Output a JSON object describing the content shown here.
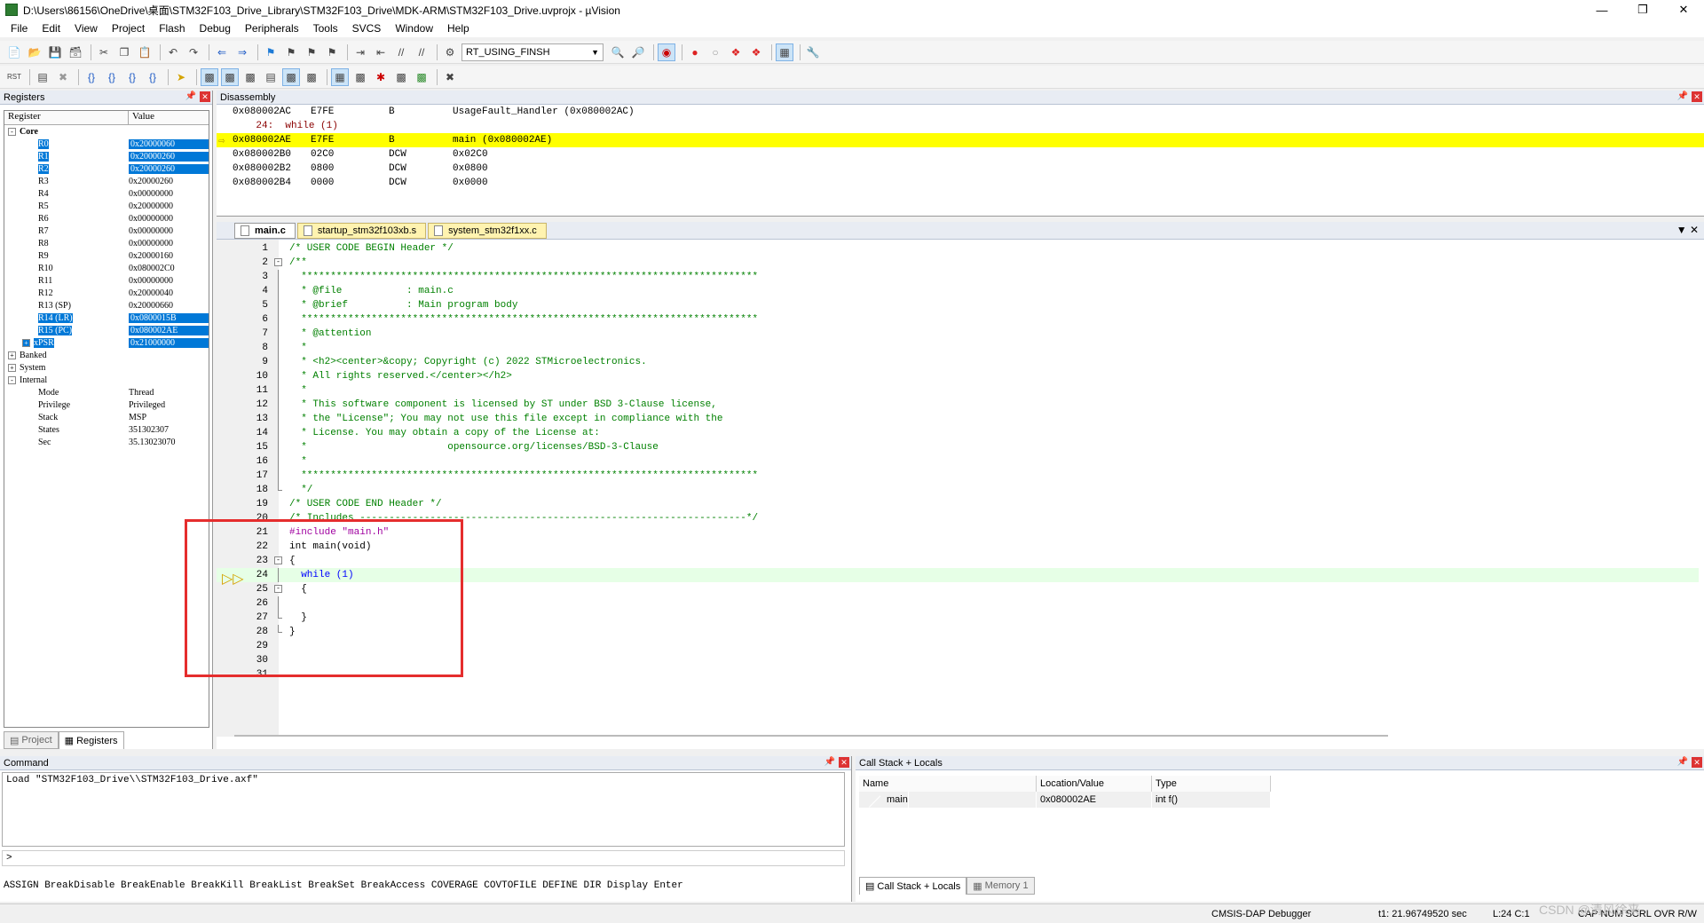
{
  "window": {
    "title": "D:\\Users\\86156\\OneDrive\\桌面\\STM32F103_Drive_Library\\STM32F103_Drive\\MDK-ARM\\STM32F103_Drive.uvprojx - µVision"
  },
  "menu": [
    "File",
    "Edit",
    "View",
    "Project",
    "Flash",
    "Debug",
    "Peripherals",
    "Tools",
    "SVCS",
    "Window",
    "Help"
  ],
  "toolbar": {
    "target": "RT_USING_FINSH"
  },
  "registers": {
    "title": "Registers",
    "col_register": "Register",
    "col_value": "Value",
    "rows": [
      {
        "name": "Core",
        "value": "",
        "depth": 0,
        "expander": "-",
        "selected": false
      },
      {
        "name": "R0",
        "value": "0x20000060",
        "depth": 2,
        "selected": true
      },
      {
        "name": "R1",
        "value": "0x20000260",
        "depth": 2,
        "selected": true
      },
      {
        "name": "R2",
        "value": "0x20000260",
        "depth": 2,
        "selected": true
      },
      {
        "name": "R3",
        "value": "0x20000260",
        "depth": 2,
        "selected": false
      },
      {
        "name": "R4",
        "value": "0x00000000",
        "depth": 2,
        "selected": false
      },
      {
        "name": "R5",
        "value": "0x20000000",
        "depth": 2,
        "selected": false
      },
      {
        "name": "R6",
        "value": "0x00000000",
        "depth": 2,
        "selected": false
      },
      {
        "name": "R7",
        "value": "0x00000000",
        "depth": 2,
        "selected": false
      },
      {
        "name": "R8",
        "value": "0x00000000",
        "depth": 2,
        "selected": false
      },
      {
        "name": "R9",
        "value": "0x20000160",
        "depth": 2,
        "selected": false
      },
      {
        "name": "R10",
        "value": "0x080002C0",
        "depth": 2,
        "selected": false
      },
      {
        "name": "R11",
        "value": "0x00000000",
        "depth": 2,
        "selected": false
      },
      {
        "name": "R12",
        "value": "0x20000040",
        "depth": 2,
        "selected": false
      },
      {
        "name": "R13 (SP)",
        "value": "0x20000660",
        "depth": 2,
        "selected": false
      },
      {
        "name": "R14 (LR)",
        "value": "0x0800015B",
        "depth": 2,
        "selected": true
      },
      {
        "name": "R15 (PC)",
        "value": "0x080002AE",
        "depth": 2,
        "selected": true
      },
      {
        "name": "xPSR",
        "value": "0x21000000",
        "depth": 2,
        "expander": "+",
        "selected": true
      },
      {
        "name": "Banked",
        "value": "",
        "depth": 0,
        "expander": "+",
        "selected": false
      },
      {
        "name": "System",
        "value": "",
        "depth": 0,
        "expander": "+",
        "selected": false
      },
      {
        "name": "Internal",
        "value": "",
        "depth": 0,
        "expander": "-",
        "selected": false
      },
      {
        "name": "Mode",
        "value": "Thread",
        "depth": 2,
        "selected": false
      },
      {
        "name": "Privilege",
        "value": "Privileged",
        "depth": 2,
        "selected": false
      },
      {
        "name": "Stack",
        "value": "MSP",
        "depth": 2,
        "selected": false
      },
      {
        "name": "States",
        "value": "351302307",
        "depth": 2,
        "selected": false
      },
      {
        "name": "Sec",
        "value": "35.13023070",
        "depth": 2,
        "selected": false
      }
    ],
    "tabs": [
      "Project",
      "Registers"
    ]
  },
  "disassembly": {
    "title": "Disassembly",
    "lines": [
      {
        "addr": "0x080002AC",
        "op": "E7FE",
        "mn": "B",
        "arg": "UsageFault_Handler (0x080002AC)",
        "src": false,
        "cur": false
      },
      {
        "text": "    24:  while (1)",
        "src": true,
        "cur": false
      },
      {
        "addr": "0x080002AE",
        "op": "E7FE",
        "mn": "B",
        "arg": "main (0x080002AE)",
        "src": false,
        "cur": true
      },
      {
        "addr": "0x080002B0",
        "op": "02C0",
        "mn": "DCW",
        "arg": "0x02C0",
        "src": false,
        "cur": false
      },
      {
        "addr": "0x080002B2",
        "op": "0800",
        "mn": "DCW",
        "arg": "0x0800",
        "src": false,
        "cur": false
      },
      {
        "addr": "0x080002B4",
        "op": "0000",
        "mn": "DCW",
        "arg": "0x0000",
        "src": false,
        "cur": false
      }
    ]
  },
  "editor": {
    "tabs": [
      {
        "label": "main.c",
        "active": true
      },
      {
        "label": "startup_stm32f103xb.s",
        "active": false
      },
      {
        "label": "system_stm32f1xx.c",
        "active": false
      }
    ],
    "lines": [
      {
        "n": "1",
        "code": "/* USER CODE BEGIN Header */",
        "cls": "c-comment",
        "fold": ""
      },
      {
        "n": "2",
        "code": "/**",
        "cls": "c-comment",
        "fold": "box"
      },
      {
        "n": "3",
        "code": "  ******************************************************************************",
        "cls": "c-comment",
        "fold": "line"
      },
      {
        "n": "4",
        "code": "  * @file           : main.c",
        "cls": "c-comment",
        "fold": "line"
      },
      {
        "n": "5",
        "code": "  * @brief          : Main program body",
        "cls": "c-comment",
        "fold": "line"
      },
      {
        "n": "6",
        "code": "  ******************************************************************************",
        "cls": "c-comment",
        "fold": "line"
      },
      {
        "n": "7",
        "code": "  * @attention",
        "cls": "c-comment",
        "fold": "line"
      },
      {
        "n": "8",
        "code": "  *",
        "cls": "c-comment",
        "fold": "line"
      },
      {
        "n": "9",
        "code": "  * <h2><center>&copy; Copyright (c) 2022 STMicroelectronics.",
        "cls": "c-comment",
        "fold": "line"
      },
      {
        "n": "10",
        "code": "  * All rights reserved.</center></h2>",
        "cls": "c-comment",
        "fold": "line"
      },
      {
        "n": "11",
        "code": "  *",
        "cls": "c-comment",
        "fold": "line"
      },
      {
        "n": "12",
        "code": "  * This software component is licensed by ST under BSD 3-Clause license,",
        "cls": "c-comment",
        "fold": "line"
      },
      {
        "n": "13",
        "code": "  * the \"License\"; You may not use this file except in compliance with the",
        "cls": "c-comment",
        "fold": "line"
      },
      {
        "n": "14",
        "code": "  * License. You may obtain a copy of the License at:",
        "cls": "c-comment",
        "fold": "line"
      },
      {
        "n": "15",
        "code": "  *                        opensource.org/licenses/BSD-3-Clause",
        "cls": "c-comment",
        "fold": "line"
      },
      {
        "n": "16",
        "code": "  *",
        "cls": "c-comment",
        "fold": "line"
      },
      {
        "n": "17",
        "code": "  ******************************************************************************",
        "cls": "c-comment",
        "fold": "line"
      },
      {
        "n": "18",
        "code": "  */",
        "cls": "c-comment",
        "fold": "end"
      },
      {
        "n": "19",
        "code": "/* USER CODE END Header */",
        "cls": "c-comment",
        "fold": ""
      },
      {
        "n": "20",
        "code": "/* Includes ------------------------------------------------------------------*/",
        "cls": "c-comment",
        "fold": ""
      },
      {
        "n": "21",
        "code": "#include \"main.h\"",
        "cls": "c-pre",
        "fold": ""
      },
      {
        "n": "22",
        "code": "int main(void)",
        "cls": "",
        "fold": ""
      },
      {
        "n": "23",
        "code": "{",
        "cls": "",
        "fold": "box"
      },
      {
        "n": "24",
        "code": "  while (1)",
        "cls": "c-key",
        "fold": "line",
        "hl": true
      },
      {
        "n": "25",
        "code": "  {",
        "cls": "",
        "fold": "box"
      },
      {
        "n": "26",
        "code": "",
        "cls": "",
        "fold": "line"
      },
      {
        "n": "27",
        "code": "  }",
        "cls": "",
        "fold": "end"
      },
      {
        "n": "28",
        "code": "}",
        "cls": "",
        "fold": "end"
      },
      {
        "n": "29",
        "code": "",
        "cls": "",
        "fold": ""
      },
      {
        "n": "30",
        "code": "",
        "cls": "",
        "fold": ""
      },
      {
        "n": "31",
        "code": "",
        "cls": "",
        "fold": ""
      }
    ]
  },
  "command": {
    "title": "Command",
    "output": "Load \"STM32F103_Drive\\\\STM32F103_Drive.axf\"",
    "prompt": ">",
    "keywords": "ASSIGN BreakDisable BreakEnable BreakKill BreakList BreakSet BreakAccess COVERAGE COVTOFILE DEFINE DIR Display Enter"
  },
  "callstack": {
    "title": "Call Stack + Locals",
    "col_name": "Name",
    "col_location": "Location/Value",
    "col_type": "Type",
    "rows": [
      {
        "name": "main",
        "location": "0x080002AE",
        "type": "int f()"
      }
    ],
    "tabs": [
      "Call Stack + Locals",
      "Memory 1"
    ]
  },
  "status": {
    "debugger": "CMSIS-DAP Debugger",
    "time": "t1: 21.96749520 sec",
    "position": "L:24 C:1",
    "flags": "CAP  NUM  SCRL  OVR  R/W",
    "watermark": "CSDN @清风徐来"
  }
}
